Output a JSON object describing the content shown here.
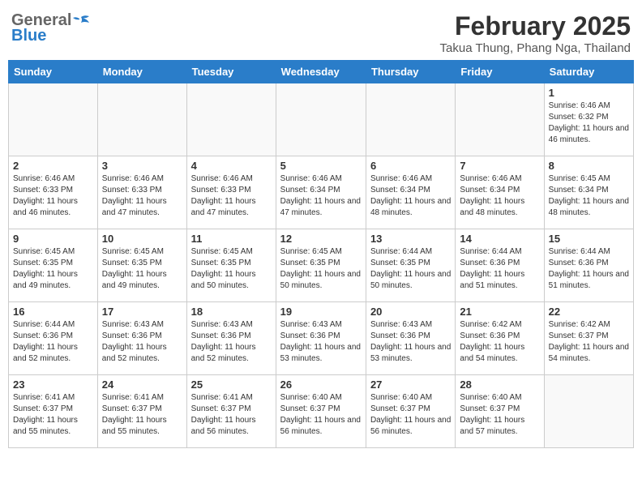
{
  "header": {
    "logo_general": "General",
    "logo_blue": "Blue",
    "month": "February 2025",
    "location": "Takua Thung, Phang Nga, Thailand"
  },
  "weekdays": [
    "Sunday",
    "Monday",
    "Tuesday",
    "Wednesday",
    "Thursday",
    "Friday",
    "Saturday"
  ],
  "weeks": [
    [
      {
        "day": "",
        "info": ""
      },
      {
        "day": "",
        "info": ""
      },
      {
        "day": "",
        "info": ""
      },
      {
        "day": "",
        "info": ""
      },
      {
        "day": "",
        "info": ""
      },
      {
        "day": "",
        "info": ""
      },
      {
        "day": "1",
        "info": "Sunrise: 6:46 AM\nSunset: 6:32 PM\nDaylight: 11 hours and 46 minutes."
      }
    ],
    [
      {
        "day": "2",
        "info": "Sunrise: 6:46 AM\nSunset: 6:33 PM\nDaylight: 11 hours and 46 minutes."
      },
      {
        "day": "3",
        "info": "Sunrise: 6:46 AM\nSunset: 6:33 PM\nDaylight: 11 hours and 47 minutes."
      },
      {
        "day": "4",
        "info": "Sunrise: 6:46 AM\nSunset: 6:33 PM\nDaylight: 11 hours and 47 minutes."
      },
      {
        "day": "5",
        "info": "Sunrise: 6:46 AM\nSunset: 6:34 PM\nDaylight: 11 hours and 47 minutes."
      },
      {
        "day": "6",
        "info": "Sunrise: 6:46 AM\nSunset: 6:34 PM\nDaylight: 11 hours and 48 minutes."
      },
      {
        "day": "7",
        "info": "Sunrise: 6:46 AM\nSunset: 6:34 PM\nDaylight: 11 hours and 48 minutes."
      },
      {
        "day": "8",
        "info": "Sunrise: 6:45 AM\nSunset: 6:34 PM\nDaylight: 11 hours and 48 minutes."
      }
    ],
    [
      {
        "day": "9",
        "info": "Sunrise: 6:45 AM\nSunset: 6:35 PM\nDaylight: 11 hours and 49 minutes."
      },
      {
        "day": "10",
        "info": "Sunrise: 6:45 AM\nSunset: 6:35 PM\nDaylight: 11 hours and 49 minutes."
      },
      {
        "day": "11",
        "info": "Sunrise: 6:45 AM\nSunset: 6:35 PM\nDaylight: 11 hours and 50 minutes."
      },
      {
        "day": "12",
        "info": "Sunrise: 6:45 AM\nSunset: 6:35 PM\nDaylight: 11 hours and 50 minutes."
      },
      {
        "day": "13",
        "info": "Sunrise: 6:44 AM\nSunset: 6:35 PM\nDaylight: 11 hours and 50 minutes."
      },
      {
        "day": "14",
        "info": "Sunrise: 6:44 AM\nSunset: 6:36 PM\nDaylight: 11 hours and 51 minutes."
      },
      {
        "day": "15",
        "info": "Sunrise: 6:44 AM\nSunset: 6:36 PM\nDaylight: 11 hours and 51 minutes."
      }
    ],
    [
      {
        "day": "16",
        "info": "Sunrise: 6:44 AM\nSunset: 6:36 PM\nDaylight: 11 hours and 52 minutes."
      },
      {
        "day": "17",
        "info": "Sunrise: 6:43 AM\nSunset: 6:36 PM\nDaylight: 11 hours and 52 minutes."
      },
      {
        "day": "18",
        "info": "Sunrise: 6:43 AM\nSunset: 6:36 PM\nDaylight: 11 hours and 52 minutes."
      },
      {
        "day": "19",
        "info": "Sunrise: 6:43 AM\nSunset: 6:36 PM\nDaylight: 11 hours and 53 minutes."
      },
      {
        "day": "20",
        "info": "Sunrise: 6:43 AM\nSunset: 6:36 PM\nDaylight: 11 hours and 53 minutes."
      },
      {
        "day": "21",
        "info": "Sunrise: 6:42 AM\nSunset: 6:36 PM\nDaylight: 11 hours and 54 minutes."
      },
      {
        "day": "22",
        "info": "Sunrise: 6:42 AM\nSunset: 6:37 PM\nDaylight: 11 hours and 54 minutes."
      }
    ],
    [
      {
        "day": "23",
        "info": "Sunrise: 6:41 AM\nSunset: 6:37 PM\nDaylight: 11 hours and 55 minutes."
      },
      {
        "day": "24",
        "info": "Sunrise: 6:41 AM\nSunset: 6:37 PM\nDaylight: 11 hours and 55 minutes."
      },
      {
        "day": "25",
        "info": "Sunrise: 6:41 AM\nSunset: 6:37 PM\nDaylight: 11 hours and 56 minutes."
      },
      {
        "day": "26",
        "info": "Sunrise: 6:40 AM\nSunset: 6:37 PM\nDaylight: 11 hours and 56 minutes."
      },
      {
        "day": "27",
        "info": "Sunrise: 6:40 AM\nSunset: 6:37 PM\nDaylight: 11 hours and 56 minutes."
      },
      {
        "day": "28",
        "info": "Sunrise: 6:40 AM\nSunset: 6:37 PM\nDaylight: 11 hours and 57 minutes."
      },
      {
        "day": "",
        "info": ""
      }
    ]
  ]
}
